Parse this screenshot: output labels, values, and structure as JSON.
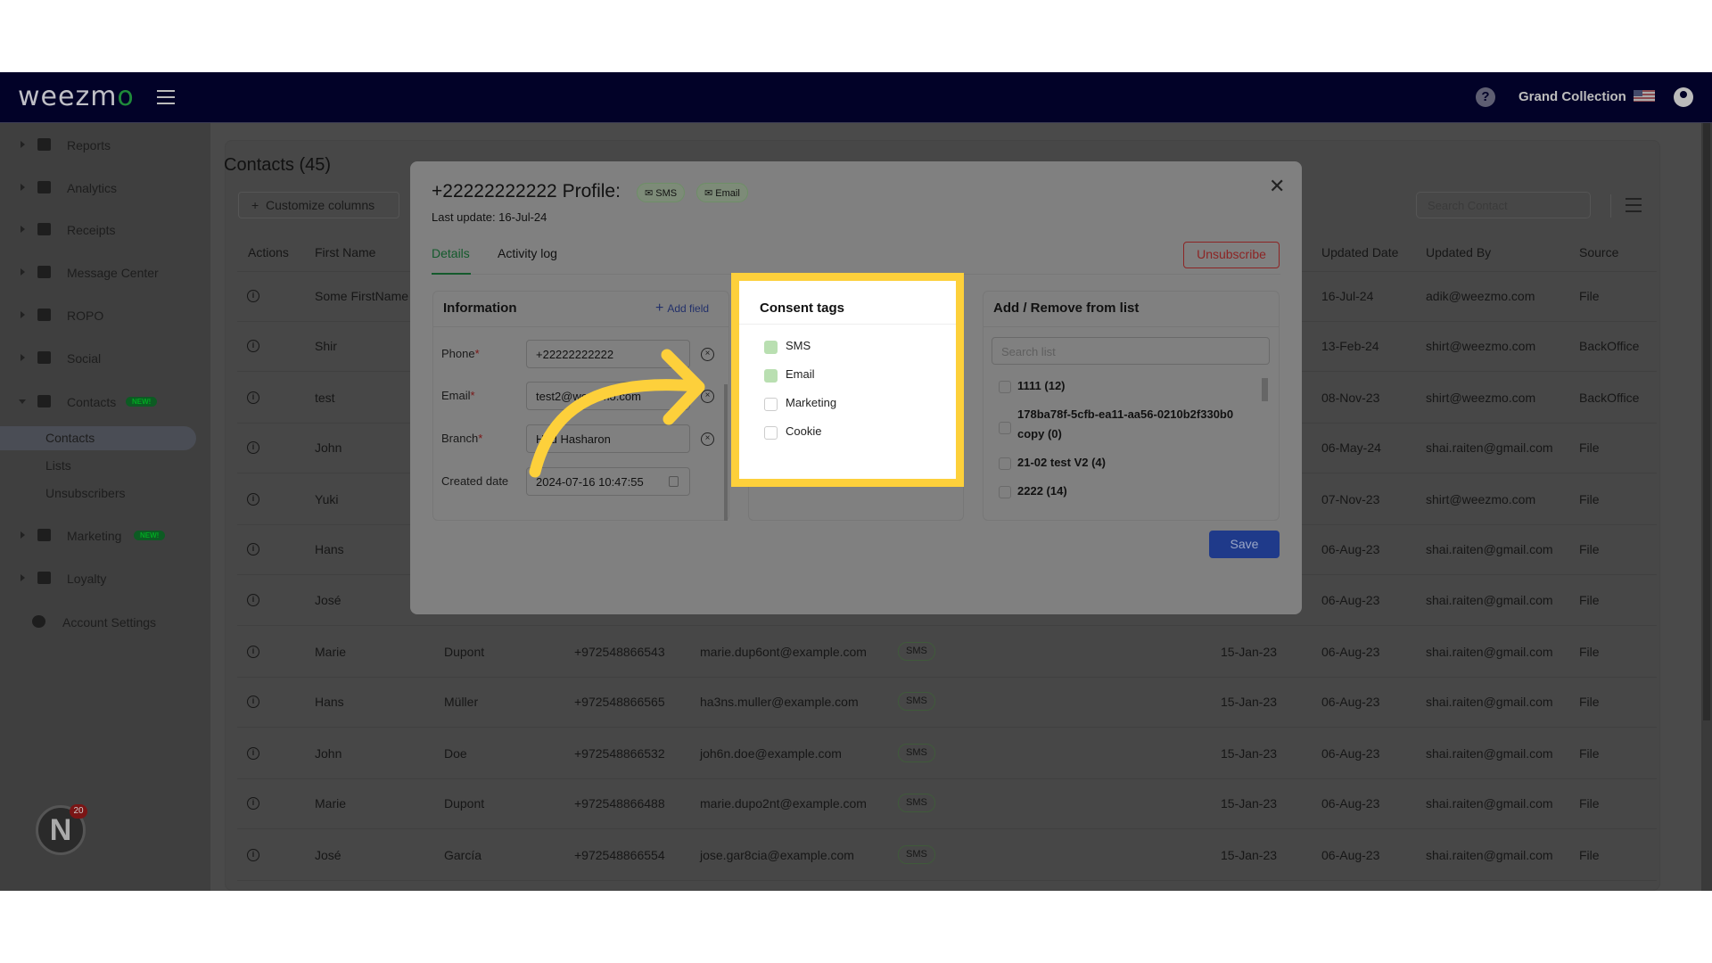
{
  "topbar": {
    "logo": "weezmo",
    "store": "Grand Collection",
    "navy": "#020228"
  },
  "sidebar": {
    "items": [
      {
        "label": "Reports",
        "icon": "dashboard-icon"
      },
      {
        "label": "Analytics",
        "icon": "chart-icon"
      },
      {
        "label": "Receipts",
        "icon": "receipt-icon"
      },
      {
        "label": "Message Center",
        "icon": "chat-icon"
      },
      {
        "label": "ROPO",
        "icon": "infinity-icon"
      },
      {
        "label": "Social",
        "icon": "people-icon"
      },
      {
        "label": "Contacts",
        "icon": "contacts-icon",
        "badge": "NEW!",
        "expanded": true
      },
      {
        "label": "Marketing",
        "icon": "megaphone-icon",
        "badge": "NEW!"
      },
      {
        "label": "Loyalty",
        "icon": "tag-icon"
      },
      {
        "label": "Account Settings",
        "icon": "gear-icon"
      }
    ],
    "subitems": [
      "Contacts",
      "Lists",
      "Unsubscribers"
    ],
    "notification_count": "20"
  },
  "contacts": {
    "title": "Contacts (45)",
    "customize": "Customize columns",
    "search_placeholder": "Search Contact",
    "headers": {
      "actions": "Actions",
      "first": "First Name",
      "updated": "Updated Date",
      "updated_by": "Updated By",
      "source": "Source"
    },
    "rows": [
      {
        "first": "Some FirstName",
        "last": null,
        "phone": null,
        "email": null,
        "tag": null,
        "created": null,
        "updated": "16-Jul-24",
        "by": "adik@weezmo.com",
        "source": "File"
      },
      {
        "first": "Shir",
        "updated": "13-Feb-24",
        "by": "shirt@weezmo.com",
        "source": "BackOffice"
      },
      {
        "first": "test",
        "updated": "08-Nov-23",
        "by": "shirt@weezmo.com",
        "source": "BackOffice"
      },
      {
        "first": "John",
        "updated": "06-May-24",
        "by": "shai.raiten@gmail.com",
        "source": "File"
      },
      {
        "first": "Yuki",
        "updated": "07-Nov-23",
        "by": "shirt@weezmo.com",
        "source": "File"
      },
      {
        "first": "Hans",
        "updated": "06-Aug-23",
        "by": "shai.raiten@gmail.com",
        "source": "File"
      },
      {
        "first": "José",
        "updated": "06-Aug-23",
        "by": "shai.raiten@gmail.com",
        "source": "File"
      },
      {
        "first": "Marie",
        "last": "Dupont",
        "phone": "+972548866543",
        "email": "marie.dup6ont@example.com",
        "tag": "SMS",
        "created": "15-Jan-23",
        "updated": "06-Aug-23",
        "by": "shai.raiten@gmail.com",
        "source": "File"
      },
      {
        "first": "Hans",
        "last": "Müller",
        "phone": "+972548866565",
        "email": "ha3ns.muller@example.com",
        "tag": "SMS",
        "created": "15-Jan-23",
        "updated": "06-Aug-23",
        "by": "shai.raiten@gmail.com",
        "source": "File"
      },
      {
        "first": "John",
        "last": "Doe",
        "phone": "+972548866532",
        "email": "joh6n.doe@example.com",
        "tag": "SMS",
        "created": "15-Jan-23",
        "updated": "06-Aug-23",
        "by": "shai.raiten@gmail.com",
        "source": "File"
      },
      {
        "first": "Marie",
        "last": "Dupont",
        "phone": "+972548866488",
        "email": "marie.dupo2nt@example.com",
        "tag": "SMS",
        "created": "15-Jan-23",
        "updated": "06-Aug-23",
        "by": "shai.raiten@gmail.com",
        "source": "File"
      },
      {
        "first": "José",
        "last": "García",
        "phone": "+972548866554",
        "email": "jose.gar8cia@example.com",
        "tag": "SMS",
        "created": "15-Jan-23",
        "updated": "06-Aug-23",
        "by": "shai.raiten@gmail.com",
        "source": "File"
      }
    ]
  },
  "modal": {
    "title": "+22222222222 Profile:",
    "badges": [
      "SMS",
      "Email"
    ],
    "last_update": "Last update: 16-Jul-24",
    "tabs": [
      "Details",
      "Activity log"
    ],
    "unsubscribe": "Unsubscribe",
    "save": "Save",
    "info": {
      "title": "Information",
      "add_field": "Add field",
      "fields": [
        {
          "label": "Phone",
          "value": "+22222222222",
          "required": "*"
        },
        {
          "label": "Email",
          "value": "test2@weezmo.com",
          "required": "*"
        },
        {
          "label": "Branch",
          "value": "Hod Hasharon",
          "required": "*"
        },
        {
          "label": "Created date",
          "value": "2024-07-16 10:47:55"
        }
      ]
    },
    "consent": {
      "title": "Consent tags",
      "tags": [
        {
          "label": "SMS",
          "checked": true
        },
        {
          "label": "Email",
          "checked": true
        },
        {
          "label": "Marketing",
          "checked": false
        },
        {
          "label": "Cookie",
          "checked": false
        }
      ],
      "highlight_color": "#fdd03b",
      "checked_color": "#b9dfb1"
    },
    "lists": {
      "title": "Add / Remove from list",
      "search_placeholder": "Search list",
      "items": [
        "1111 (12)",
        "178ba78f-5cfb-ea11-aa56-0210b2f330b0 copy (0)",
        "21-02 test V2 (4)",
        "2222 (14)"
      ]
    }
  }
}
